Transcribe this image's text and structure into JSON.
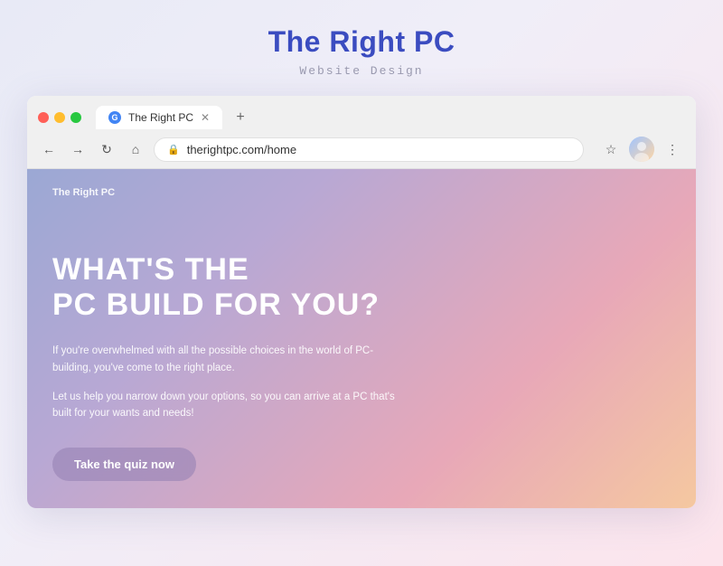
{
  "header": {
    "title": "The Right PC",
    "subtitle": "Website Design"
  },
  "browser": {
    "tab_label": "The Right PC",
    "tab_favicon_letter": "G",
    "url": "therightpc.com/home",
    "new_tab_symbol": "+",
    "back_symbol": "←",
    "forward_symbol": "→",
    "reload_symbol": "↻",
    "home_symbol": "⌂",
    "lock_symbol": "🔒",
    "star_symbol": "☆",
    "menu_symbol": "⋮"
  },
  "website": {
    "logo": "The Right PC",
    "headline_line1": "WHAT'S THE",
    "headline_line2": "PC BUILD FOR YOU?",
    "description_1": "If you're overwhelmed with all the possible choices in the world of PC-building, you've come to the right place.",
    "description_2": "Let us help you narrow down your options, so you can arrive at a PC that's built for your wants and needs!",
    "cta_button": "Take the quiz now"
  },
  "colors": {
    "page_title": "#3b4cc0",
    "page_subtitle": "#9b9bb0",
    "cta_bg": "rgba(150,130,180,0.6)"
  }
}
